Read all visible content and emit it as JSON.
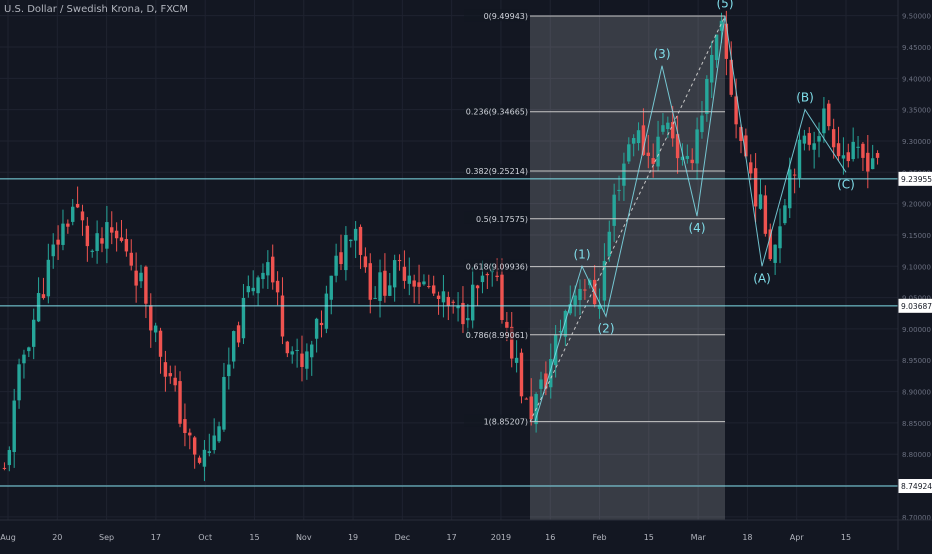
{
  "symbol_title": "U.S. Dollar / Swedish Krona, D, FXCM",
  "colors": {
    "background": "#131722",
    "grid": "#1f2330",
    "up": "#26a69a",
    "down": "#ef5350",
    "hline": "#80deea",
    "fib": "#c7c7c7",
    "fib_shade": "rgba(255,255,255,0.16)",
    "wave": "#80deea",
    "axis_text": "#b2b5be"
  },
  "chart_data": {
    "type": "candlestick",
    "title": "U.S. Dollar / Swedish Krona, D, FXCM",
    "x_tick_labels": [
      "Aug",
      "20",
      "Sep",
      "17",
      "Oct",
      "15",
      "Nov",
      "19",
      "Dec",
      "17",
      "2019",
      "16",
      "Feb",
      "15",
      "Mar",
      "18",
      "Apr",
      "15"
    ],
    "y_tick_labels": [
      "9.50000",
      "9.45000",
      "9.40000",
      "9.35000",
      "9.30000",
      "9.25000",
      "9.20000",
      "9.15000",
      "9.10000",
      "9.05000",
      "9.00000",
      "8.95000",
      "8.90000",
      "8.85000",
      "8.80000",
      "8.75000",
      "8.70000"
    ],
    "ylim": [
      8.695,
      9.525
    ],
    "grid": true,
    "horizontal_levels": [
      {
        "value": 9.23955,
        "label": "9.23955"
      },
      {
        "value": 9.03687,
        "label": "9.03687"
      },
      {
        "value": 8.74924,
        "label": "8.74924"
      }
    ],
    "fibonacci": [
      {
        "ratio": "0",
        "value": 9.49943,
        "label": "0(9.49943)"
      },
      {
        "ratio": "0.236",
        "value": 9.34665,
        "label": "0.236(9.34665)"
      },
      {
        "ratio": "0.382",
        "value": 9.25214,
        "label": "0.382(9.25214)"
      },
      {
        "ratio": "0.5",
        "value": 9.17575,
        "label": "0.5(9.17575)"
      },
      {
        "ratio": "0.618",
        "value": 9.09936,
        "label": "0.618(9.09936)"
      },
      {
        "ratio": "0.786",
        "value": 8.99061,
        "label": "0.786(8.99061)"
      },
      {
        "ratio": "1",
        "value": 8.85207,
        "label": "1(8.85207)"
      }
    ],
    "elliott_waves": [
      {
        "label": "(1)",
        "value": 9.1
      },
      {
        "label": "(2)",
        "value": 9.02
      },
      {
        "label": "(3)",
        "value": 9.42
      },
      {
        "label": "(4)",
        "value": 9.18
      },
      {
        "label": "(5)",
        "value": 9.5
      },
      {
        "label": "(A)",
        "value": 9.1
      },
      {
        "label": "(B)",
        "value": 9.35
      },
      {
        "label": "(C)",
        "value": 9.25
      }
    ],
    "close_path": [
      {
        "date": "Aug",
        "close": 8.77
      },
      {
        "date": "Aug",
        "close": 8.95
      },
      {
        "date": "Aug",
        "close": 9.05
      },
      {
        "date": "Aug",
        "close": 9.14
      },
      {
        "date": "20",
        "close": 9.2
      },
      {
        "date": "20",
        "close": 9.12
      },
      {
        "date": "20",
        "close": 9.15
      },
      {
        "date": "Sep",
        "close": 9.13
      },
      {
        "date": "Sep",
        "close": 9.06
      },
      {
        "date": "Sep",
        "close": 8.96
      },
      {
        "date": "17",
        "close": 8.87
      },
      {
        "date": "17",
        "close": 8.78
      },
      {
        "date": "17",
        "close": 8.82
      },
      {
        "date": "Oct",
        "close": 8.96
      },
      {
        "date": "Oct",
        "close": 9.06
      },
      {
        "date": "Oct",
        "close": 9.12
      },
      {
        "date": "15",
        "close": 9.0
      },
      {
        "date": "15",
        "close": 8.93
      },
      {
        "date": "15",
        "close": 9.0
      },
      {
        "date": "Nov",
        "close": 9.1
      },
      {
        "date": "Nov",
        "close": 9.18
      },
      {
        "date": "Nov",
        "close": 9.06
      },
      {
        "date": "19",
        "close": 9.08
      },
      {
        "date": "19",
        "close": 9.1
      },
      {
        "date": "Dec",
        "close": 9.07
      },
      {
        "date": "Dec",
        "close": 9.04
      },
      {
        "date": "17",
        "close": 9.02
      },
      {
        "date": "17",
        "close": 9.06
      },
      {
        "date": "17",
        "close": 9.08
      },
      {
        "date": "2019",
        "close": 8.98
      },
      {
        "date": "2019",
        "close": 8.86
      },
      {
        "date": "16",
        "close": 8.92
      },
      {
        "date": "16",
        "close": 9.02
      },
      {
        "date": "16",
        "close": 9.08
      },
      {
        "date": "Feb",
        "close": 9.04
      },
      {
        "date": "Feb",
        "close": 9.22
      },
      {
        "date": "Feb",
        "close": 9.32
      },
      {
        "date": "15",
        "close": 9.27
      },
      {
        "date": "15",
        "close": 9.34
      },
      {
        "date": "15",
        "close": 9.24
      },
      {
        "date": "Mar",
        "close": 9.36
      },
      {
        "date": "Mar",
        "close": 9.48
      },
      {
        "date": "Mar",
        "close": 9.32
      },
      {
        "date": "18",
        "close": 9.22
      },
      {
        "date": "18",
        "close": 9.12
      },
      {
        "date": "18",
        "close": 9.26
      },
      {
        "date": "Apr",
        "close": 9.3
      },
      {
        "date": "Apr",
        "close": 9.34
      },
      {
        "date": "Apr",
        "close": 9.28
      },
      {
        "date": "15",
        "close": 9.27
      },
      {
        "date": "15",
        "close": 9.28
      }
    ]
  }
}
